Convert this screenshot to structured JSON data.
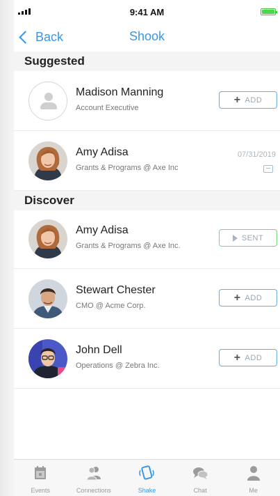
{
  "status_bar": {
    "time": "9:41 AM"
  },
  "nav": {
    "back_label": "Back",
    "title": "Shook"
  },
  "sections": {
    "suggested": "Suggested",
    "discover": "Discover"
  },
  "suggested": [
    {
      "name": "Madison Manning",
      "subtitle": "Account Executive",
      "action": "ADD"
    },
    {
      "name": "Amy Adisa",
      "subtitle": "Grants & Programs @ Axe Inc",
      "date": "07/31/2019"
    }
  ],
  "discover": [
    {
      "name": "Amy Adisa",
      "subtitle": "Grants & Programs @ Axe Inc.",
      "action": "SENT"
    },
    {
      "name": "Stewart Chester",
      "subtitle": "CMO @ Acme Corp.",
      "action": "ADD"
    },
    {
      "name": "John Dell",
      "subtitle": "Operations @ Zebra Inc.",
      "action": "ADD"
    }
  ],
  "tabs": [
    {
      "label": "Events",
      "icon": "calendar-icon"
    },
    {
      "label": "Connections",
      "icon": "people-icon"
    },
    {
      "label": "Shake",
      "icon": "shake-phone-icon",
      "active": true
    },
    {
      "label": "Chat",
      "icon": "chat-bubbles-icon"
    },
    {
      "label": "Me",
      "icon": "person-icon"
    }
  ],
  "colors": {
    "accent": "#3a97e6",
    "add_border": "#6aaedc",
    "sent_border": "#7bd67b"
  }
}
